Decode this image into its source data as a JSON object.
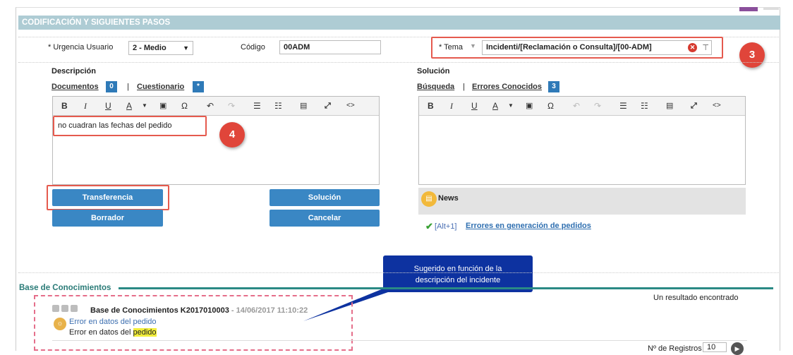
{
  "header": {
    "title": "CODIFICACIÓN Y SIGUIENTES PASOS"
  },
  "form": {
    "urgencia_label": "* Urgencia Usuario",
    "urgencia_value": "2 - Medio",
    "codigo_label": "Código",
    "codigo_value": "00ADM",
    "tema_label": "* Tema",
    "tema_value": "Incidenti/[Reclamación o Consulta]/[00-ADM]"
  },
  "descripcion": {
    "title": "Descripción",
    "documentos_label": "Documentos",
    "documentos_count": "0",
    "separator": "|",
    "cuestionario_label": "Cuestionario",
    "cuestionario_badge": "*",
    "text": "no cuadran las fechas del pedido"
  },
  "solucion": {
    "title": "Solución",
    "busqueda_label": "Búsqueda",
    "separator": "|",
    "errores_label": "Errores Conocidos",
    "errores_count": "3"
  },
  "toolbar": {
    "bold": "B",
    "italic": "I",
    "underline": "U",
    "font_color": "A",
    "special_char": "Ω",
    "source": "<>"
  },
  "buttons": {
    "transferencia": "Transferencia",
    "borrador": "Borrador",
    "solucion": "Solución",
    "cancelar": "Cancelar"
  },
  "news": {
    "title": "News",
    "shortcut": "[Alt+1]",
    "link": "Errores en generación de pedidos"
  },
  "annotations": {
    "step3": "3",
    "step4": "4",
    "callout_line1": "Sugerido en función de la",
    "callout_line2": "descripción del incidente"
  },
  "knowledge": {
    "title": "Base de Conocimientos",
    "result_count_text": "Un resultado encontrado",
    "item_title": "Base de Conocimientos K2017010003",
    "item_date": " - 14/06/2017 11:10:22",
    "item_subtitle": "Error en datos del pedido",
    "item_text_prefix": "Error en datos del ",
    "item_text_highlight": "pedido",
    "registros_label": "Nº de Registros",
    "registros_value": "10"
  },
  "colors": {
    "header_bg": "#aeccd4",
    "accent_blue": "#3a87c4",
    "annotation_red": "#e55a4e",
    "callout_bg": "#0d32a0",
    "kb_line": "#2a8a85",
    "highlight": "#f2ee3a"
  },
  "icons": [
    "dropdown-arrow-icon",
    "clear-icon",
    "tree-icon",
    "news-icon",
    "check-icon",
    "lightbulb-icon",
    "thumb-icon",
    "pager-next-icon"
  ]
}
